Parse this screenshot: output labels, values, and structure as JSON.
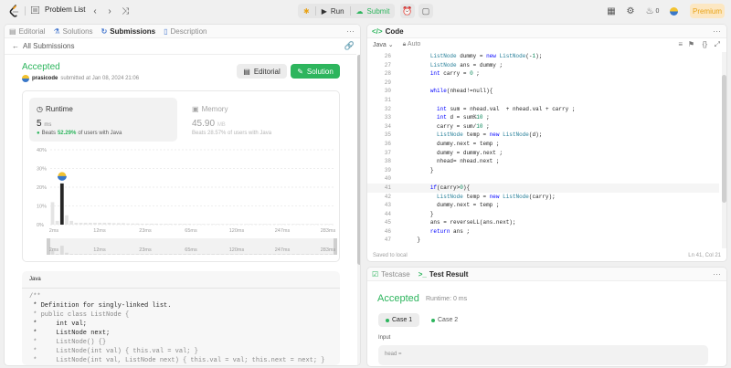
{
  "topnav": {
    "problem_list": "Problem List",
    "run": "Run",
    "submit": "Submit",
    "fire_count": "0",
    "premium": "Premium"
  },
  "left_tabs": [
    {
      "label": "Editorial"
    },
    {
      "label": "Solutions"
    },
    {
      "label": "Submissions"
    },
    {
      "label": "Description"
    }
  ],
  "submission": {
    "back_label": "All Submissions",
    "status": "Accepted",
    "username": "prasicode",
    "submitted_text": "submitted at Jan 08, 2024 21:06",
    "editorial_btn": "Editorial",
    "solution_btn": "Solution"
  },
  "runtime": {
    "title": "Runtime",
    "value": "5",
    "unit": "ms",
    "beats_prefix": "Beats",
    "beats_pct": "52.29%",
    "beats_suffix": "of users with Java"
  },
  "memory": {
    "title": "Memory",
    "value": "45.90",
    "unit": "MB",
    "beats_text": "Beats 28.57% of users with Java"
  },
  "chart_data": {
    "type": "bar",
    "y_ticks": [
      "40%",
      "30%",
      "20%",
      "10%",
      "0%"
    ],
    "ylim": [
      0,
      40
    ],
    "x_ticks": [
      "2ms",
      "12ms",
      "23ms",
      "65ms",
      "120ms",
      "247ms",
      "283ms"
    ],
    "values": [
      12,
      2,
      22,
      5,
      2,
      1,
      1,
      1,
      1,
      1,
      1,
      1,
      1,
      0.8,
      0.8,
      0.8,
      0.6,
      0.6,
      0.6,
      0.5,
      0.5,
      0.5,
      0.5,
      0.4,
      0.4,
      0.4,
      0.4,
      0.4,
      0.4,
      0.4,
      0.3,
      0.3,
      0.3,
      0.3,
      0.3,
      0.3,
      0.3,
      0.3,
      0.3,
      0.3,
      0.3,
      0.3,
      0.3,
      0.3,
      0.3,
      0.3,
      0.3,
      0.3,
      0.3,
      0.3,
      0.3,
      0.3,
      0.3,
      0.3,
      0.3,
      0.3,
      0.3,
      0.3,
      0.3,
      0.3
    ],
    "highlight_index": 2,
    "mini_x_ticks": [
      "2ms",
      "12ms",
      "23ms",
      "65ms",
      "120ms",
      "247ms",
      "283ms"
    ],
    "colors": {
      "bar": "#e4e4e4",
      "highlight": "#262626"
    }
  },
  "lang_card": {
    "language": "Java",
    "code_lines": [
      "/**",
      " * Definition for singly-linked list.",
      " * public class ListNode {",
      " *     int val;",
      " *     ListNode next;",
      " *     ListNode() {}",
      " *     ListNode(int val) { this.val = val; }",
      " *     ListNode(int val, ListNode next) { this.val = val; this.next = next; }"
    ]
  },
  "code_panel": {
    "title": "Code",
    "language": "Java",
    "mode": "Auto",
    "saved": "Saved to local",
    "cursor": "Ln 41, Col 21",
    "line_numbers": [
      "26",
      "27",
      "28",
      "29",
      "30",
      "31",
      "32",
      "33",
      "34",
      "35",
      "36",
      "37",
      "38",
      "39",
      "40",
      "41",
      "42",
      "43",
      "44",
      "45",
      "46",
      "47"
    ],
    "lines": [
      "        ListNode dummy = new ListNode(-1);",
      "        ListNode ans = dummy ;",
      "        int carry = 0 ;",
      "",
      "        while(nhead!=null){",
      "",
      "          int sum = nhead.val  + nhead.val + carry ;",
      "          int d = sum%10 ;",
      "          carry = sum/10 ;",
      "          ListNode temp = new ListNode(d);",
      "          dummy.next = temp ;",
      "          dummy = dummy.next ;",
      "          nhead= nhead.next ;",
      "        }",
      "",
      "        if(carry>0){",
      "          ListNode temp = new ListNode(carry);",
      "          dummy.next = temp ;",
      "        }",
      "        ans = reverseLL(ans.next);",
      "        return ans ;",
      "    }"
    ]
  },
  "test_panel": {
    "tab_testcase": "Testcase",
    "tab_result": "Test Result",
    "status": "Accepted",
    "runtime": "Runtime: 0 ms",
    "case1": "Case 1",
    "case2": "Case 2",
    "input_label": "Input",
    "input_value": "head ="
  }
}
